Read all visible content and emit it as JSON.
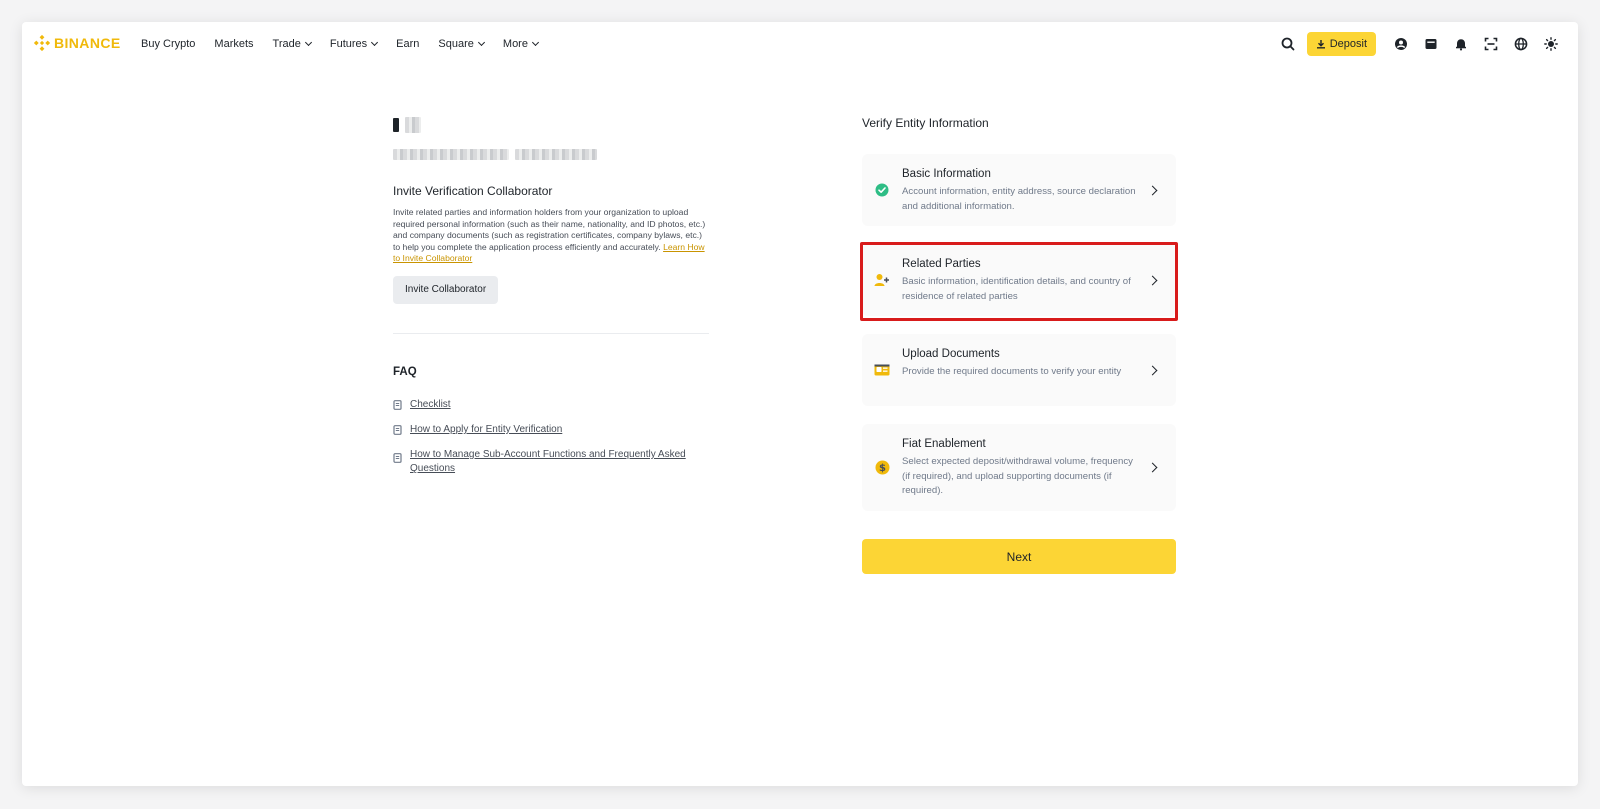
{
  "brand": {
    "name": "BINANCE",
    "color": "#F0B90B"
  },
  "nav": [
    {
      "label": "Buy Crypto",
      "dropdown": false
    },
    {
      "label": "Markets",
      "dropdown": false
    },
    {
      "label": "Trade",
      "dropdown": true
    },
    {
      "label": "Futures",
      "dropdown": true
    },
    {
      "label": "Earn",
      "dropdown": false
    },
    {
      "label": "Square",
      "dropdown": true
    },
    {
      "label": "More",
      "dropdown": true
    }
  ],
  "header_actions": {
    "deposit_label": "Deposit",
    "icons": [
      "search-icon",
      "download-icon",
      "profile-icon",
      "wallet-icon",
      "bell-icon",
      "qr-scan-icon",
      "globe-icon",
      "theme-icon"
    ]
  },
  "left": {
    "invite_title": "Invite Verification Collaborator",
    "invite_desc": "Invite related parties and information holders from your organization to upload required personal information (such as their name, nationality, and ID photos, etc.) and company documents (such as registration certificates, company bylaws, etc.) to help you complete the application process efficiently and accurately.",
    "invite_link": "Learn How to Invite Collaborator",
    "invite_button": "Invite Collaborator",
    "faq_title": "FAQ",
    "faq": [
      "Checklist",
      "How to Apply for Entity Verification",
      "How to Manage Sub-Account Functions and Frequently Asked Questions"
    ]
  },
  "right": {
    "title": "Verify Entity Information",
    "cards": [
      {
        "title": "Basic Information",
        "desc": "Account information, entity address, source declaration and additional information.",
        "icon": "check-circle-icon",
        "status": "completed"
      },
      {
        "title": "Related Parties",
        "desc": "Basic information, identification details, and country of residence of related parties",
        "icon": "user-add-icon",
        "status": "highlighted"
      },
      {
        "title": "Upload Documents",
        "desc": "Provide the required documents to verify your entity",
        "icon": "id-card-icon",
        "status": "pending"
      },
      {
        "title": "Fiat Enablement",
        "desc": "Select expected deposit/withdrawal volume, frequency (if required), and upload supporting documents (if required).",
        "icon": "dollar-coin-icon",
        "status": "pending"
      }
    ],
    "next_button": "Next"
  },
  "colors": {
    "accent": "#FCD535",
    "success": "#2EBD85",
    "highlight": "#D81B1B"
  }
}
